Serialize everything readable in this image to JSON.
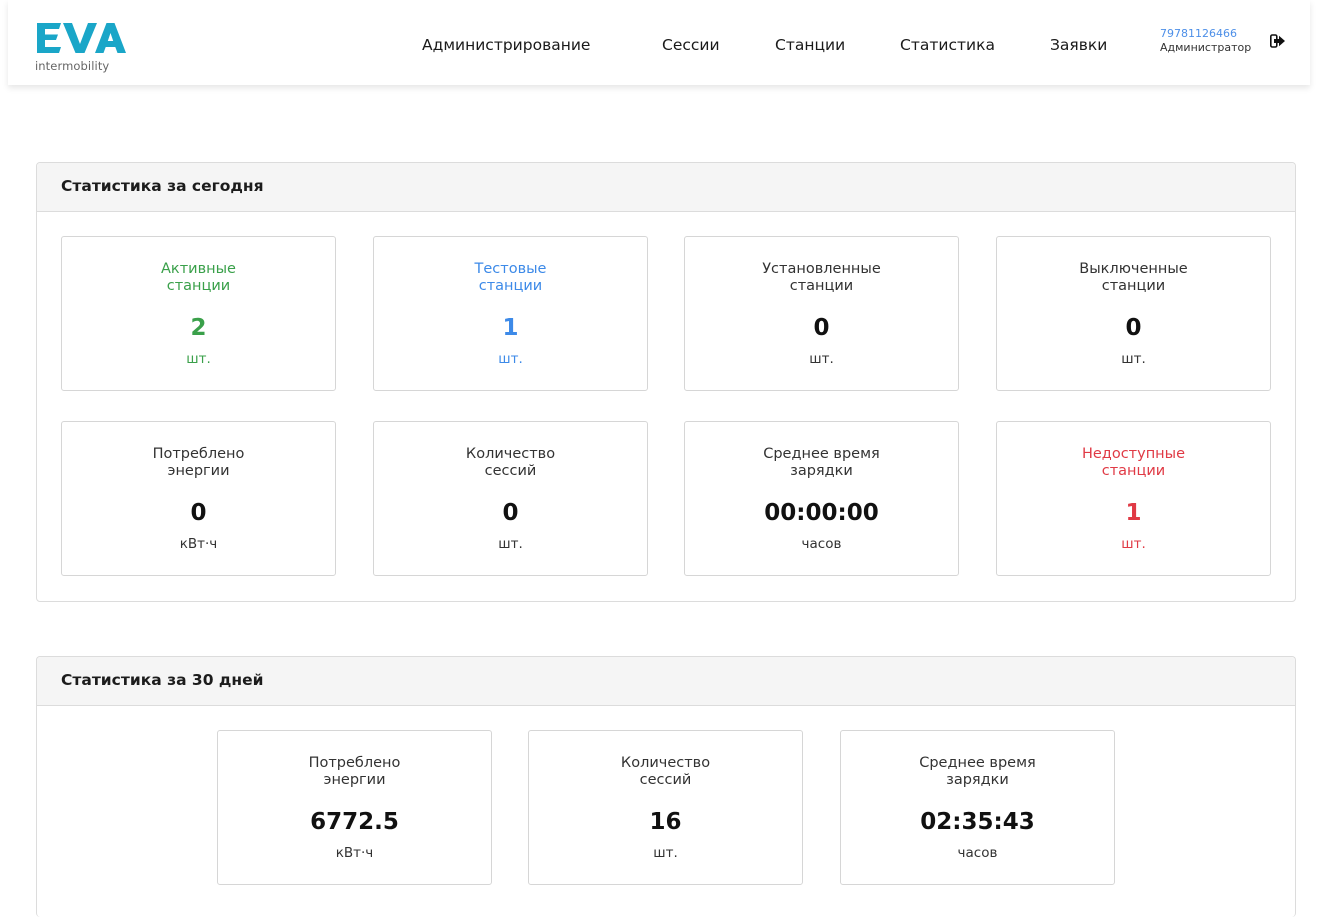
{
  "header": {
    "logo": {
      "text": "EVA",
      "tagline": "intermobility"
    },
    "nav": [
      "Администрирование",
      "Сессии",
      "Станции",
      "Статистика",
      "Заявки"
    ],
    "user": {
      "phone": "79781126466",
      "role": "Администратор"
    },
    "logout_icon": "sign-out-icon"
  },
  "today": {
    "title": "Статистика за сегодня",
    "cards": [
      {
        "label1": "Активные",
        "label2": "станции",
        "value": "2",
        "unit": "шт.",
        "color": "#3aa04a"
      },
      {
        "label1": "Тестовые",
        "label2": "станции",
        "value": "1",
        "unit": "шт.",
        "color": "#3d8ae8"
      },
      {
        "label1": "Установленные",
        "label2": "станции",
        "value": "0",
        "unit": "шт."
      },
      {
        "label1": "Выключенные",
        "label2": "станции",
        "value": "0",
        "unit": "шт."
      },
      {
        "label1": "Потреблено",
        "label2": "энергии",
        "value": "0",
        "unit": "кВт·ч"
      },
      {
        "label1": "Количество",
        "label2": "сессий",
        "value": "0",
        "unit": "шт."
      },
      {
        "label1": "Среднее время",
        "label2": "зарядки",
        "value": "00:00:00",
        "unit": "часов"
      },
      {
        "label1": "Недоступные",
        "label2": "станции",
        "value": "1",
        "unit": "шт.",
        "color": "#e03a45"
      }
    ]
  },
  "month": {
    "title": "Статистика за 30 дней",
    "cards": [
      {
        "label1": "Потреблено",
        "label2": "энергии",
        "value": "6772.5",
        "unit": "кВт·ч"
      },
      {
        "label1": "Количество",
        "label2": "сессий",
        "value": "16",
        "unit": "шт."
      },
      {
        "label1": "Среднее время",
        "label2": "зарядки",
        "value": "02:35:43",
        "unit": "часов"
      }
    ]
  },
  "colors": {
    "accent": "#4d8fe8",
    "logo": "#1aa6c8",
    "green": "#3aa04a",
    "blue": "#3d8ae8",
    "red": "#e03a45"
  }
}
